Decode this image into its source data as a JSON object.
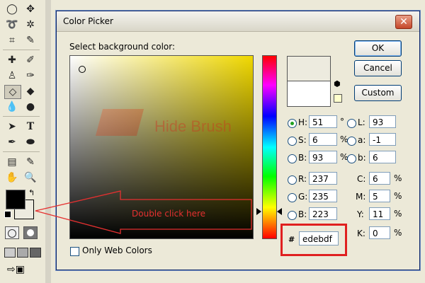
{
  "dialog": {
    "title": "Color Picker",
    "close_glyph": "✕",
    "prompt": "Select background color:",
    "buttons": {
      "ok": "OK",
      "cancel": "Cancel",
      "custom": "Custom"
    },
    "only_web_colors": "Only Web Colors",
    "hex_prefix": "#",
    "hex_value": "edebdf",
    "current_color": "#ffffff",
    "new_color": "#edebdf",
    "fields": {
      "H": {
        "label": "H:",
        "value": "51",
        "unit": "°"
      },
      "S": {
        "label": "S:",
        "value": "6",
        "unit": "%"
      },
      "B": {
        "label": "B:",
        "value": "93",
        "unit": "%"
      },
      "R": {
        "label": "R:",
        "value": "237",
        "unit": ""
      },
      "G": {
        "label": "G:",
        "value": "235",
        "unit": ""
      },
      "Bb": {
        "label": "B:",
        "value": "223",
        "unit": ""
      },
      "L": {
        "label": "L:",
        "value": "93",
        "unit": ""
      },
      "a": {
        "label": "a:",
        "value": "-1",
        "unit": ""
      },
      "b": {
        "label": "b:",
        "value": "6",
        "unit": ""
      },
      "C": {
        "label": "C:",
        "value": "6",
        "unit": "%"
      },
      "M": {
        "label": "M:",
        "value": "5",
        "unit": "%"
      },
      "Y": {
        "label": "Y:",
        "value": "11",
        "unit": "%"
      },
      "K": {
        "label": "K:",
        "value": "0",
        "unit": "%"
      }
    }
  },
  "annotation": {
    "text": "Double click here",
    "color": "#e53030"
  },
  "watermark": {
    "text": "Hide Brush",
    "color": "#d03020"
  },
  "colors": {
    "field_hue": "#f0d800",
    "fg_swatch": "#000000",
    "bg_swatch": "#edebdf",
    "highlight": "#e02020"
  },
  "toolbox_icons": [
    "marquee-ellipse-icon",
    "move-icon",
    "lasso-icon",
    "magic-wand-icon",
    "crop-icon",
    "slice-icon",
    "healing-brush-icon",
    "brush-icon",
    "clone-stamp-icon",
    "history-brush-icon",
    "eraser-icon",
    "paint-bucket-icon",
    "blur-icon",
    "dodge-icon",
    "path-select-icon",
    "type-icon",
    "pen-icon",
    "shape-icon",
    "notes-icon",
    "eyedropper-icon",
    "hand-icon",
    "zoom-icon"
  ]
}
